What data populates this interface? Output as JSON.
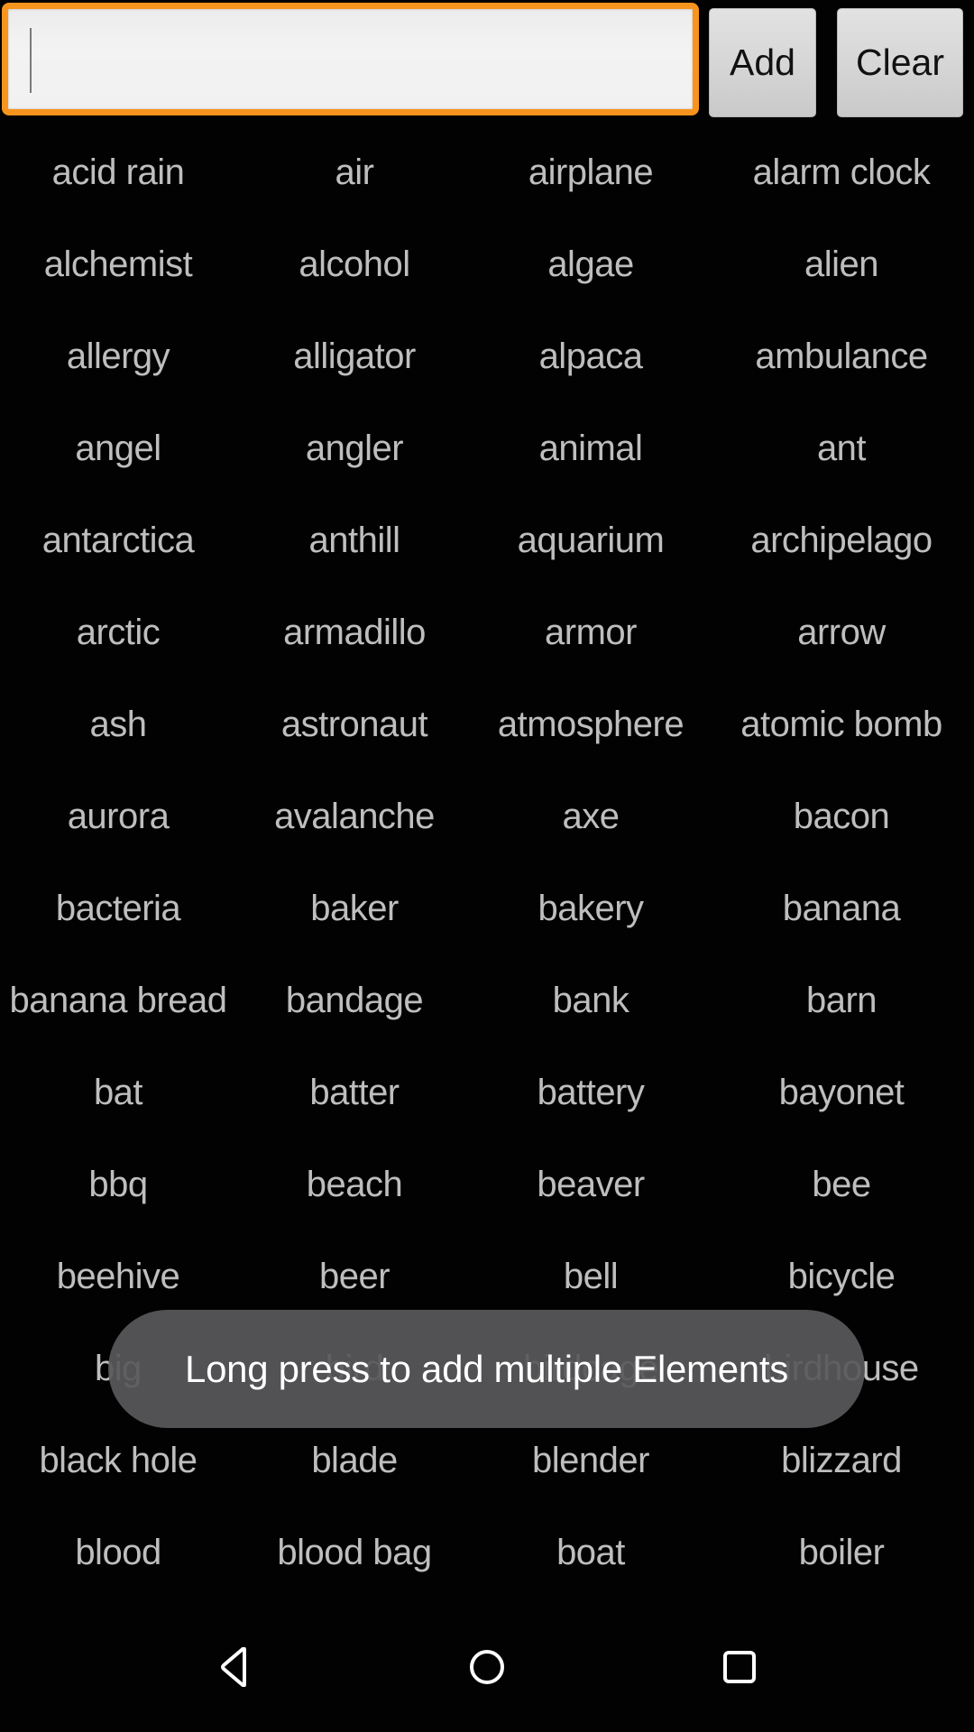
{
  "toolbar": {
    "input_value": "",
    "input_placeholder": "",
    "add_label": "Add",
    "clear_label": "Clear"
  },
  "colors": {
    "accent_focus": "#f7941d",
    "item_text": "#bebebe",
    "toast_bg": "#58585a"
  },
  "elements": [
    "acid rain",
    "air",
    "airplane",
    "alarm clock",
    "alchemist",
    "alcohol",
    "algae",
    "alien",
    "allergy",
    "alligator",
    "alpaca",
    "ambulance",
    "angel",
    "angler",
    "animal",
    "ant",
    "antarctica",
    "anthill",
    "aquarium",
    "archipelago",
    "arctic",
    "armadillo",
    "armor",
    "arrow",
    "ash",
    "astronaut",
    "atmosphere",
    "atomic bomb",
    "aurora",
    "avalanche",
    "axe",
    "bacon",
    "bacteria",
    "baker",
    "bakery",
    "banana",
    "banana bread",
    "bandage",
    "bank",
    "barn",
    "bat",
    "batter",
    "battery",
    "bayonet",
    "bbq",
    "beach",
    "beaver",
    "bee",
    "beehive",
    "beer",
    "bell",
    "bicycle",
    "big",
    "bird",
    "birdcage",
    "birdhouse",
    "black hole",
    "blade",
    "blender",
    "blizzard",
    "blood",
    "blood bag",
    "boat",
    "boiler"
  ],
  "toast": {
    "message": "Long press to add multiple Elements"
  },
  "navbar": {
    "back_icon": "back-triangle-icon",
    "home_icon": "home-circle-icon",
    "recents_icon": "recents-square-icon"
  }
}
